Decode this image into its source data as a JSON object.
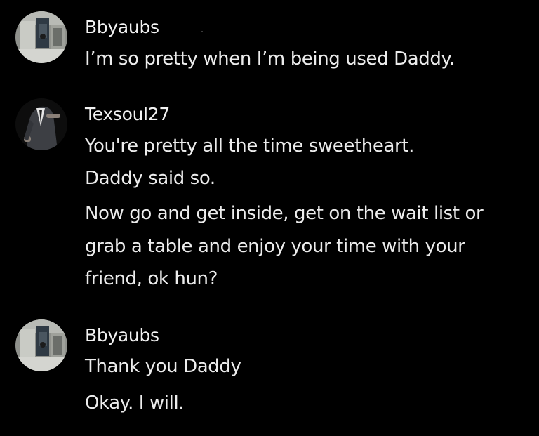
{
  "messages": [
    {
      "username": "Bbyaubs",
      "avatar_icon": "user-avatar-icon",
      "lines": [
        "I’m so pretty when I’m being used Daddy."
      ]
    },
    {
      "username": "Texsoul27",
      "avatar_icon": "user-avatar-icon",
      "lines": [
        "You're pretty all the time sweetheart.",
        "Daddy said so.",
        "Now go and get inside, get on the wait list or",
        "grab a table and enjoy your time with your",
        "friend, ok hun?"
      ]
    },
    {
      "username": "Bbyaubs",
      "avatar_icon": "user-avatar-icon",
      "lines": [
        "Thank you Daddy",
        "Okay. I will."
      ]
    }
  ],
  "colors": {
    "background": "#000000",
    "text": "#ececec"
  }
}
